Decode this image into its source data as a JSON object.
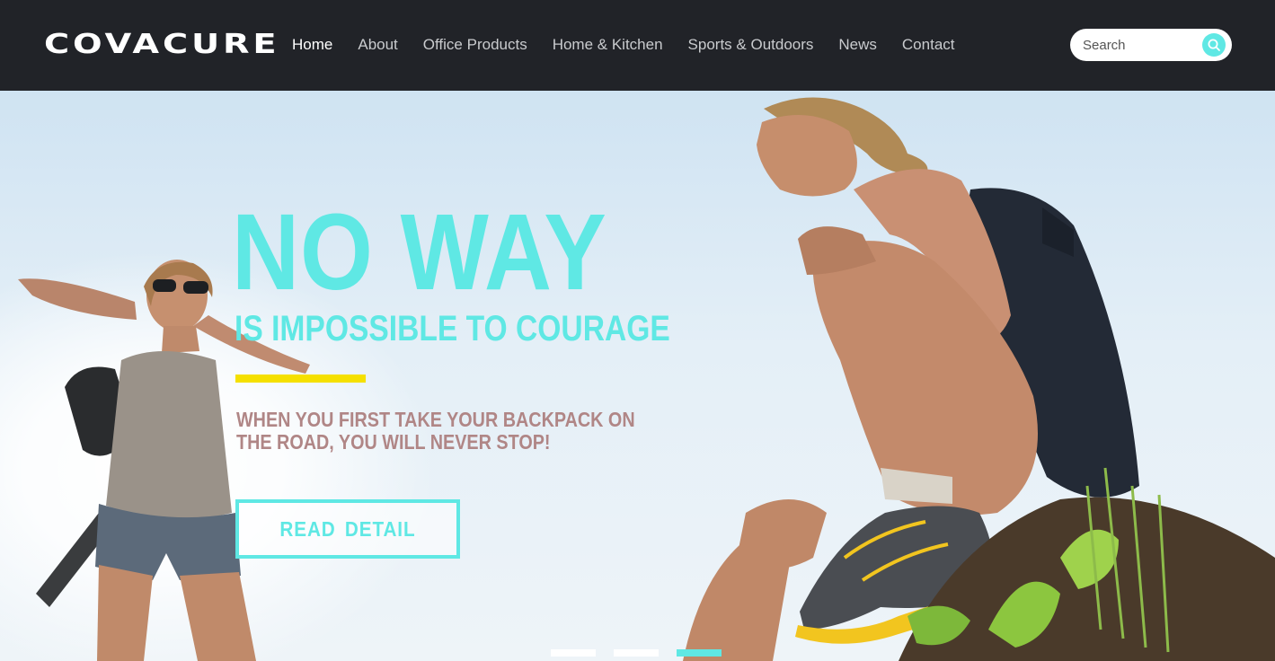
{
  "brand": {
    "logo_text": "COVACURE"
  },
  "nav": {
    "items": [
      {
        "label": "Home",
        "active": true
      },
      {
        "label": "About",
        "active": false
      },
      {
        "label": "Office Products",
        "active": false
      },
      {
        "label": "Home & Kitchen",
        "active": false
      },
      {
        "label": "Sports & Outdoors",
        "active": false
      },
      {
        "label": "News",
        "active": false
      },
      {
        "label": "Contact",
        "active": false
      }
    ]
  },
  "search": {
    "placeholder": "Search",
    "value": "",
    "icon": "search-icon"
  },
  "hero": {
    "headline": "NO WAY",
    "subheadline": "IS IMPOSSIBLE TO COURAGE",
    "tagline": "WHEN YOU FIRST TAKE YOUR BACKPACK ON THE ROAD, YOU WILL NEVER STOP!",
    "cta_label": "READ  DETAIL",
    "slides": {
      "count": 3,
      "active_index": 2
    }
  },
  "colors": {
    "header_bg": "#212328",
    "accent": "#5fe8e4",
    "highlight_bar": "#f5e000",
    "tagline": "#b08686",
    "nav_text": "#c9cbce"
  }
}
